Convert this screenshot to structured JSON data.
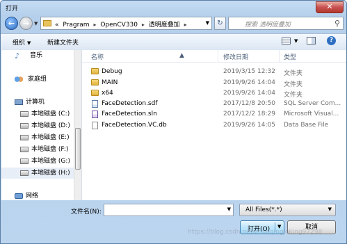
{
  "window": {
    "title": "打开",
    "close_label": "✕"
  },
  "nav": {
    "breadcrumb": [
      "«",
      "Pragram",
      "OpenCV330",
      "透明度叠加"
    ],
    "separator": "▸",
    "search_placeholder": "搜索 透明度叠加"
  },
  "toolbar": {
    "organize_label": "组织",
    "new_folder_label": "新建文件夹"
  },
  "sidebar": {
    "items": [
      {
        "label": "音乐",
        "icon": "music-icon"
      },
      {
        "label": "家庭组",
        "icon": "homegroup-icon"
      },
      {
        "label": "计算机",
        "icon": "computer-icon"
      },
      {
        "label": "本地磁盘 (C:)",
        "icon": "drive-icon"
      },
      {
        "label": "本地磁盘 (D:)",
        "icon": "drive-icon"
      },
      {
        "label": "本地磁盘 (E:)",
        "icon": "drive-icon"
      },
      {
        "label": "本地磁盘 (F:)",
        "icon": "drive-icon"
      },
      {
        "label": "本地磁盘 (G:)",
        "icon": "drive-icon"
      },
      {
        "label": "本地磁盘 (H:)",
        "icon": "drive-icon"
      },
      {
        "label": "网络",
        "icon": "network-icon"
      }
    ]
  },
  "files": {
    "columns": {
      "name": "名称",
      "date": "修改日期",
      "type": "类型"
    },
    "rows": [
      {
        "name": "Debug",
        "date": "2019/3/15 12:32",
        "type": "文件夹",
        "icon": "folder-icon"
      },
      {
        "name": "MAIN",
        "date": "2019/9/26 14:04",
        "type": "文件夹",
        "icon": "folder-icon"
      },
      {
        "name": "x64",
        "date": "2019/9/26 14:04",
        "type": "文件夹",
        "icon": "folder-icon"
      },
      {
        "name": "FaceDetection.sdf",
        "date": "2017/12/8 20:50",
        "type": "SQL Server Com...",
        "icon": "sdf-file-icon"
      },
      {
        "name": "FaceDetection.sln",
        "date": "2017/12/2 18:29",
        "type": "Microsoft Visual...",
        "icon": "sln-file-icon"
      },
      {
        "name": "FaceDetection.VC.db",
        "date": "2019/9/26 14:05",
        "type": "Data Base File",
        "icon": "db-file-icon"
      }
    ]
  },
  "bottom": {
    "filename_label": "文件名(N):",
    "filename_value": "",
    "filter_value": "All Files(*.*)",
    "open_label": "打开(O)",
    "cancel_label": "取消"
  },
  "watermark": "https://blog.csdn.net/zhuoqingjoking97298"
}
